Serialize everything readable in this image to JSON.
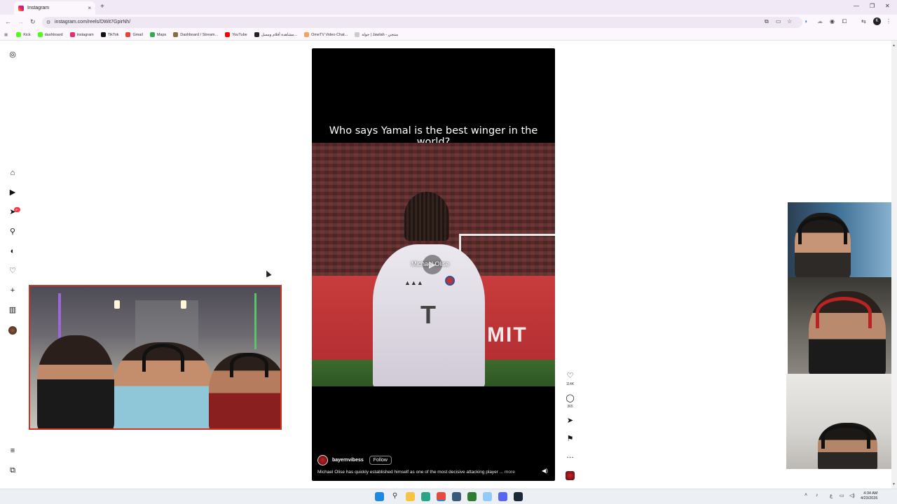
{
  "browser": {
    "tab_title": "Instagram",
    "tab_close": "×",
    "new_tab": "+",
    "url": "instagram.com/reels/DWit7GpirNh/",
    "window_controls": [
      "—",
      "❐",
      "✕"
    ]
  },
  "bookmarks": [
    {
      "label": "Kick",
      "color": "#53fc18"
    },
    {
      "label": "dashboard",
      "color": "#53fc18"
    },
    {
      "label": "instagram",
      "color": "#e1306c"
    },
    {
      "label": "TikTok",
      "color": "#111111"
    },
    {
      "label": "Gmail",
      "color": "#ea4335"
    },
    {
      "label": "Maps",
      "color": "#34a853"
    },
    {
      "label": "Dashboard / Stream...",
      "color": "#8a6d3b"
    },
    {
      "label": "YouTube",
      "color": "#ff0000"
    },
    {
      "label": "مشاهدة أفلام ومسل...",
      "color": "#222222"
    },
    {
      "label": "OmeTV Video Chat...",
      "color": "#f4a261"
    },
    {
      "label": "جولة | Jawlah - منتجي",
      "color": "#cccccc"
    }
  ],
  "sidebar": {
    "notification_badge": "9+",
    "icons": [
      "instagram-logo-icon",
      "home-icon",
      "reels-icon",
      "messages-icon",
      "search-icon",
      "explore-icon",
      "notifications-icon",
      "create-icon",
      "dashboard-icon",
      "profile-avatar",
      "menu-icon",
      "also-from-meta-icon"
    ]
  },
  "reel": {
    "overlay_title": "Who says Yamal is the best winger in the world?",
    "overlay_name": "Michael Olise",
    "sponsor_text": "MIT",
    "username": "bayernvibess",
    "follow_label": "Follow",
    "description": "Michael Olise has quickly established himself as one of the most decisive attacking player ...",
    "more_label": "more"
  },
  "actions": {
    "likes": "114K",
    "comments": "365"
  },
  "taskbar": {
    "time": "4:34 AM",
    "date": "4/23/2026",
    "tray_lang": "ع"
  }
}
